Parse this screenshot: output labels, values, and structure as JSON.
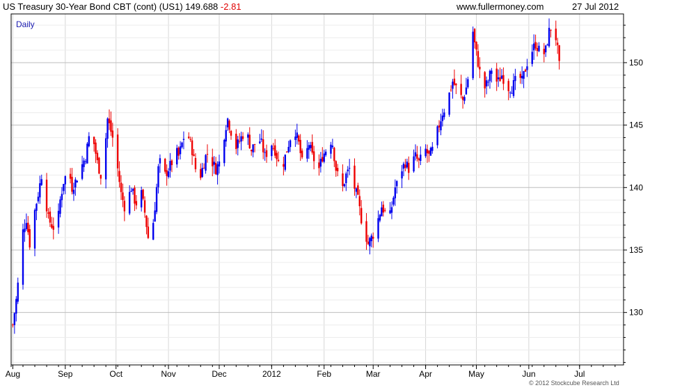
{
  "header": {
    "title": "US Treasury 30-Year  Bond CBT (cont) (US1)",
    "last_price": "149.688",
    "change": "-2.81",
    "site": "www.fullermoney.com",
    "date": "27 Jul 2012"
  },
  "plot_label": "Daily",
  "copyright": "© 2012 Stockcube Research Ltd",
  "colors": {
    "up": "#0000ee",
    "down": "#ee0000",
    "grid": "#d6d6d6",
    "axis": "#000000",
    "change_text": "#e00000"
  },
  "chart_data": {
    "type": "candlestick-bar",
    "title": "US Treasury 30-Year  Bond CBT (cont) (US1)",
    "frequency": "Daily",
    "y_axis_position": "right",
    "ylim": [
      125.8,
      153.9
    ],
    "yticks": [
      130,
      135,
      140,
      145,
      150
    ],
    "grid": true,
    "x_tick_labels": [
      "Aug",
      "Sep",
      "Oct",
      "Nov",
      "Dec",
      "2012",
      "Feb",
      "Mar",
      "Apr",
      "May",
      "Jun",
      "Jul"
    ],
    "x_label_days": [
      1,
      32,
      62,
      93,
      123,
      154,
      185,
      214,
      245,
      275,
      306,
      336
    ],
    "x_range_days": [
      0,
      362
    ],
    "price_path": [
      [
        1,
        129.0
      ],
      [
        3,
        131.0
      ],
      [
        5,
        133.5
      ],
      [
        7,
        136.5
      ],
      [
        9,
        137.5
      ],
      [
        11,
        135.5
      ],
      [
        13,
        137.5
      ],
      [
        16,
        139.5
      ],
      [
        18,
        141.0
      ],
      [
        20,
        139.5
      ],
      [
        22,
        137.5
      ],
      [
        24,
        137.0
      ],
      [
        27,
        136.5
      ],
      [
        29,
        139.0
      ],
      [
        31,
        140.5
      ],
      [
        34,
        141.5
      ],
      [
        36,
        140.0
      ],
      [
        38,
        140.5
      ],
      [
        41,
        141.5
      ],
      [
        44,
        142.5
      ],
      [
        46,
        144.0
      ],
      [
        48,
        145.5
      ],
      [
        49,
        143.5
      ],
      [
        51,
        142.0
      ],
      [
        53,
        141.0
      ],
      [
        55,
        142.5
      ],
      [
        57,
        145.5
      ],
      [
        59,
        144.5
      ],
      [
        61,
        143.5
      ],
      [
        63,
        141.5
      ],
      [
        65,
        139.5
      ],
      [
        67,
        138.5
      ],
      [
        69,
        139.0
      ],
      [
        71,
        140.0
      ],
      [
        73,
        139.0
      ],
      [
        75,
        138.5
      ],
      [
        77,
        139.5
      ],
      [
        79,
        138.0
      ],
      [
        81,
        136.0
      ],
      [
        83,
        136.0
      ],
      [
        85,
        138.5
      ],
      [
        87,
        141.5
      ],
      [
        89,
        142.5
      ],
      [
        91,
        141.0
      ],
      [
        93,
        141.5
      ],
      [
        95,
        142.0
      ],
      [
        97,
        143.0
      ],
      [
        99,
        142.5
      ],
      [
        101,
        143.5
      ],
      [
        103,
        144.5
      ],
      [
        105,
        144.0
      ],
      [
        107,
        143.0
      ],
      [
        109,
        141.5
      ],
      [
        111,
        140.5
      ],
      [
        113,
        141.5
      ],
      [
        115,
        142.5
      ],
      [
        117,
        143.0
      ],
      [
        119,
        142.0
      ],
      [
        121,
        141.5
      ],
      [
        123,
        142.0
      ],
      [
        125,
        143.5
      ],
      [
        127,
        145.0
      ],
      [
        128,
        145.5
      ],
      [
        130,
        144.5
      ],
      [
        132,
        143.0
      ],
      [
        134,
        143.5
      ],
      [
        136,
        144.0
      ],
      [
        138,
        144.5
      ],
      [
        140,
        144.0
      ],
      [
        142,
        143.0
      ],
      [
        144,
        143.5
      ],
      [
        146,
        144.0
      ],
      [
        148,
        143.5
      ],
      [
        150,
        142.5
      ],
      [
        152,
        143.0
      ],
      [
        154,
        143.5
      ],
      [
        156,
        143.0
      ],
      [
        158,
        142.0
      ],
      [
        160,
        141.5
      ],
      [
        162,
        142.5
      ],
      [
        164,
        143.5
      ],
      [
        166,
        144.5
      ],
      [
        168,
        144.5
      ],
      [
        170,
        143.5
      ],
      [
        172,
        142.0
      ],
      [
        174,
        142.5
      ],
      [
        176,
        143.5
      ],
      [
        178,
        142.5
      ],
      [
        180,
        142.0
      ],
      [
        182,
        141.5
      ],
      [
        184,
        142.5
      ],
      [
        186,
        143.0
      ],
      [
        188,
        144.0
      ],
      [
        190,
        143.5
      ],
      [
        192,
        141.5
      ],
      [
        194,
        140.5
      ],
      [
        196,
        140.0
      ],
      [
        198,
        141.0
      ],
      [
        200,
        141.5
      ],
      [
        202,
        140.5
      ],
      [
        204,
        139.5
      ],
      [
        205,
        139.0
      ],
      [
        207,
        137.5
      ],
      [
        209,
        136.5
      ],
      [
        211,
        135.5
      ],
      [
        213,
        136.0
      ],
      [
        215,
        136.5
      ],
      [
        217,
        137.5
      ],
      [
        219,
        138.5
      ],
      [
        221,
        138.0
      ],
      [
        223,
        137.0
      ],
      [
        225,
        138.5
      ],
      [
        227,
        140.0
      ],
      [
        229,
        140.5
      ],
      [
        231,
        141.5
      ],
      [
        233,
        142.0
      ],
      [
        235,
        141.5
      ],
      [
        237,
        142.0
      ],
      [
        239,
        142.5
      ],
      [
        241,
        142.0
      ],
      [
        243,
        142.5
      ],
      [
        245,
        143.0
      ],
      [
        247,
        142.5
      ],
      [
        249,
        143.0
      ],
      [
        251,
        144.0
      ],
      [
        253,
        145.0
      ],
      [
        255,
        146.0
      ],
      [
        257,
        146.5
      ],
      [
        259,
        147.5
      ],
      [
        261,
        148.5
      ],
      [
        263,
        148.0
      ],
      [
        265,
        147.5
      ],
      [
        267,
        147.0
      ],
      [
        269,
        148.0
      ],
      [
        271,
        149.5
      ],
      [
        272,
        151.0
      ],
      [
        273,
        152.5
      ],
      [
        274,
        151.5
      ],
      [
        276,
        150.0
      ],
      [
        278,
        148.5
      ],
      [
        280,
        148.0
      ],
      [
        282,
        148.5
      ],
      [
        284,
        149.5
      ],
      [
        286,
        148.5
      ],
      [
        288,
        148.5
      ],
      [
        290,
        149.0
      ],
      [
        292,
        148.5
      ],
      [
        294,
        148.0
      ],
      [
        296,
        148.0
      ],
      [
        298,
        148.5
      ],
      [
        300,
        149.0
      ],
      [
        302,
        148.5
      ],
      [
        304,
        149.5
      ],
      [
        306,
        150.5
      ],
      [
        308,
        151.0
      ],
      [
        310,
        151.5
      ],
      [
        312,
        151.0
      ],
      [
        314,
        150.5
      ],
      [
        316,
        151.0
      ],
      [
        318,
        152.5
      ],
      [
        320,
        153.0
      ],
      [
        321,
        152.8
      ],
      [
        322,
        152.0
      ],
      [
        323,
        151.0
      ],
      [
        324,
        149.7
      ]
    ]
  }
}
